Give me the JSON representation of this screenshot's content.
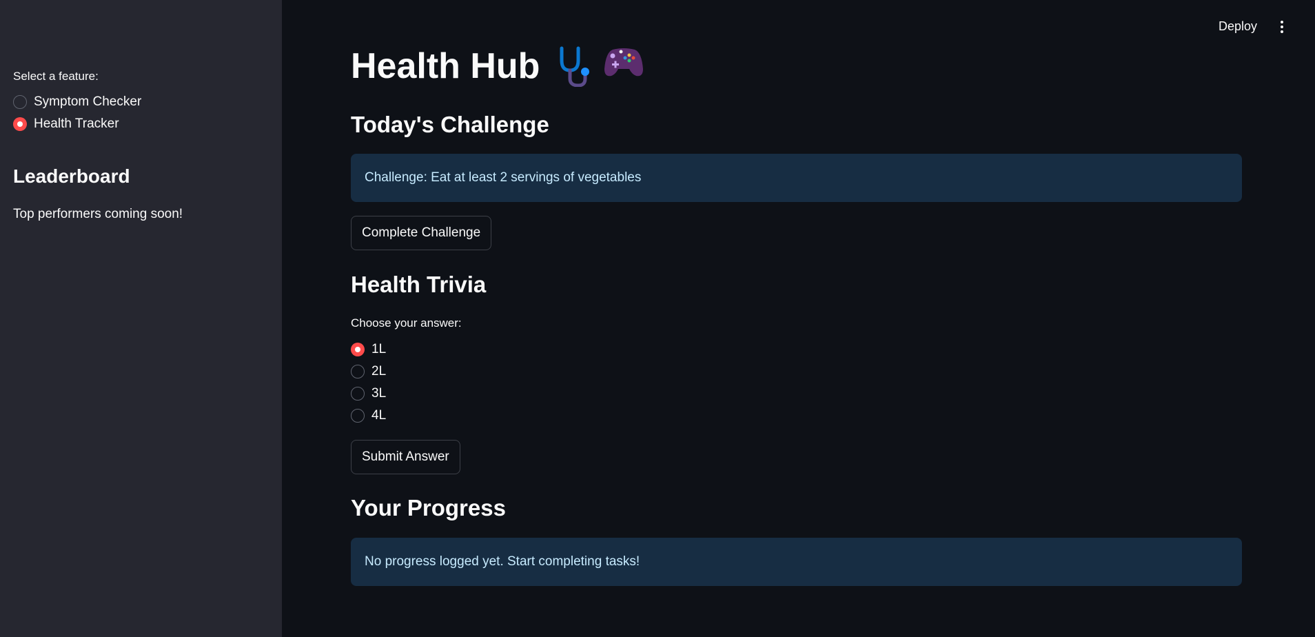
{
  "topbar": {
    "deploy_label": "Deploy"
  },
  "sidebar": {
    "select_label": "Select a feature:",
    "options": [
      {
        "label": "Symptom Checker",
        "selected": false
      },
      {
        "label": "Health Tracker",
        "selected": true
      }
    ],
    "leaderboard_heading": "Leaderboard",
    "leaderboard_text": "Top performers coming soon!"
  },
  "main": {
    "title": "Health Hub",
    "title_icons": [
      "stethoscope-icon",
      "game-controller-icon"
    ],
    "challenge": {
      "heading": "Today's Challenge",
      "info": "Challenge: Eat at least 2 servings of vegetables",
      "button_label": "Complete Challenge"
    },
    "trivia": {
      "heading": "Health Trivia",
      "question_label": "Choose your answer:",
      "options": [
        {
          "label": "1L",
          "selected": true
        },
        {
          "label": "2L",
          "selected": false
        },
        {
          "label": "3L",
          "selected": false
        },
        {
          "label": "4L",
          "selected": false
        }
      ],
      "button_label": "Submit Answer"
    },
    "progress": {
      "heading": "Your Progress",
      "info": "No progress logged yet. Start completing tasks!"
    }
  },
  "colors": {
    "background": "#0e1117",
    "sidebar": "#262730",
    "accent": "#ff4b4b",
    "info_bg": "#172d43",
    "info_text": "#c7ebff"
  }
}
